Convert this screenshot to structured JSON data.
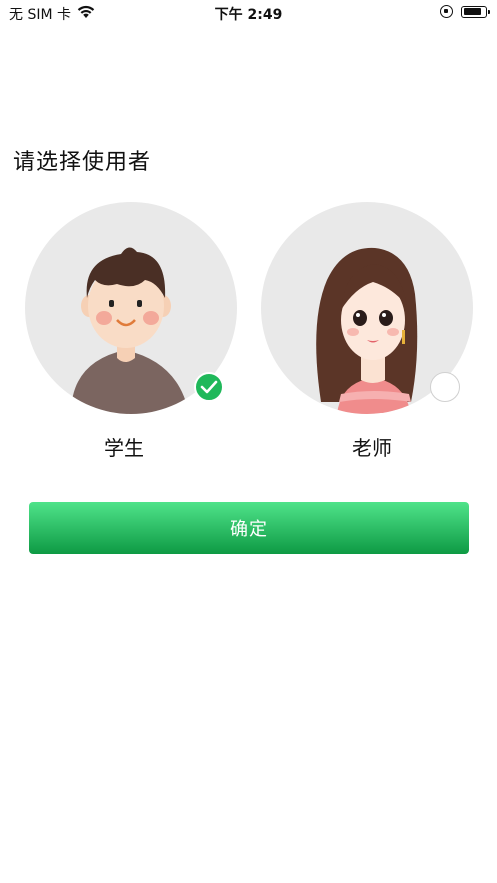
{
  "status_bar": {
    "carrier": "无 SIM 卡",
    "time": "下午 2:49",
    "battery_level": 0.85,
    "icons": [
      "wifi-icon",
      "orientation-lock-icon",
      "battery-icon"
    ]
  },
  "page": {
    "title": "请选择使用者"
  },
  "roles": [
    {
      "label": "学生",
      "selected": true
    },
    {
      "label": "老师",
      "selected": false
    }
  ],
  "confirm_button": {
    "label": "确定"
  },
  "colors": {
    "accent_green": "#1fb85a",
    "button_top": "#4fe38a",
    "button_bottom": "#0e9a44",
    "avatar_bg": "#e9e9e9"
  }
}
